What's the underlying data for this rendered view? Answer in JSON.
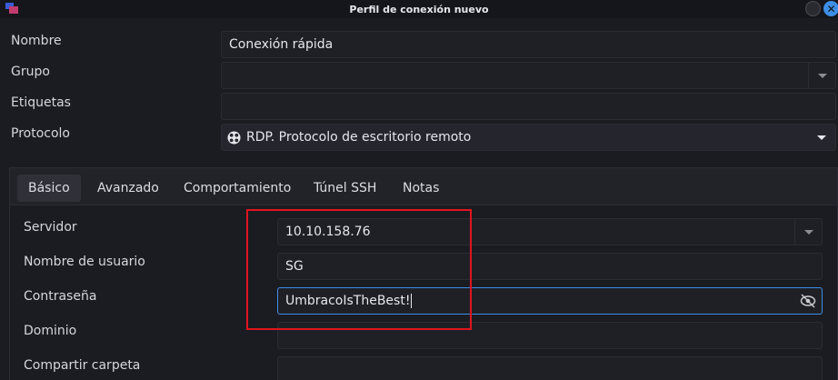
{
  "window": {
    "title": "Perfil de conexión nuevo"
  },
  "profile": {
    "name_label": "Nombre",
    "name_value": "Conexión rápida",
    "group_label": "Grupo",
    "group_value": "",
    "tags_label": "Etiquetas",
    "tags_value": "",
    "protocol_label": "Protocolo",
    "protocol_value": "RDP. Protocolo de escritorio remoto"
  },
  "tabs": [
    {
      "label": "Básico",
      "active": true
    },
    {
      "label": "Avanzado",
      "active": false
    },
    {
      "label": "Comportamiento",
      "active": false
    },
    {
      "label": "Túnel SSH",
      "active": false
    },
    {
      "label": "Notas",
      "active": false
    }
  ],
  "basic": {
    "server_label": "Servidor",
    "server_value": "10.10.158.76",
    "username_label": "Nombre de usuario",
    "username_value": "SG",
    "password_label": "Contraseña",
    "password_value": "UmbracoIsTheBest!",
    "domain_label": "Dominio",
    "domain_value": "",
    "share_label": "Compartir carpeta",
    "share_value": ""
  },
  "colors": {
    "highlight": "#e0141f",
    "focus": "#3d8ee6",
    "background": "#1b1c22"
  }
}
